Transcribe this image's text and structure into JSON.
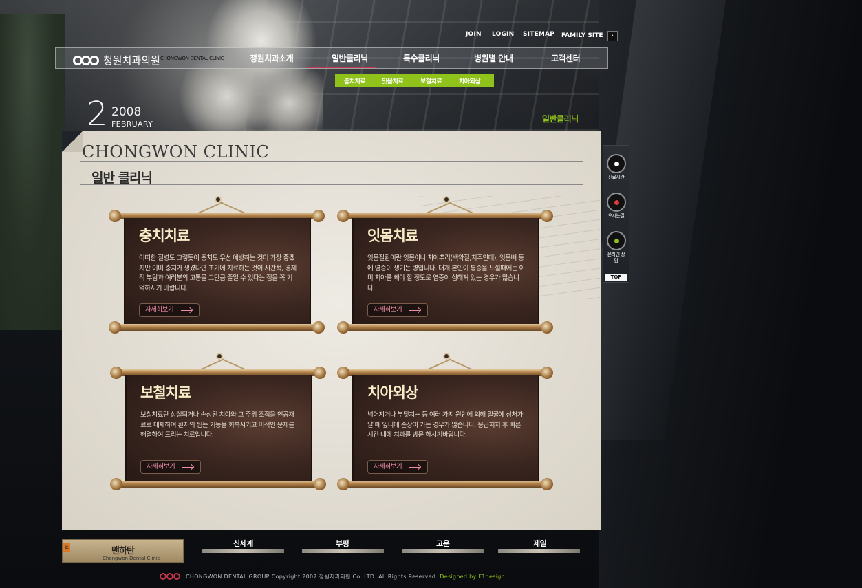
{
  "utility": {
    "join": "JOIN",
    "login": "LOGIN",
    "sitemap": "SITEMAP",
    "family_site": "FAMILY SITE",
    "family_btn": "›"
  },
  "logo": {
    "name": "청원치과의원",
    "sub": "CHONGWON DENTAL CLINIC"
  },
  "nav": {
    "items": [
      "청원치과소개",
      "일반클리닉",
      "특수클리닉",
      "병원별 안내",
      "고객센터"
    ],
    "active_index": 1
  },
  "subnav": {
    "items": [
      "충치치료",
      "잇몸치료",
      "보철치료",
      "치아외상"
    ]
  },
  "date": {
    "day": "2",
    "year": "2008",
    "month": "FEBRUARY"
  },
  "section_tag": "일반클리닉",
  "content": {
    "clinic_title": "CHONGWON CLINIC",
    "page_title": "일반 클리닉",
    "cards": [
      {
        "title": "충치치료",
        "text": "어떠한 질병도 그렇듯이 충치도 우선 예방하는 것이 가장 좋겠지만 이미 충치가 생겼다면 초기에 치료하는 것이 시간적, 경제적 부담과 여러분의 고통을 그만큼 줄일 수 있다는 점을 꼭 기억하시기 바랍니다.",
        "button": "자세히보기"
      },
      {
        "title": "잇몸치료",
        "text": "잇몸질환이란 잇몸이나 치아뿌리(백악질,치주인대), 잇몸뼈 등에 염증이 생기는 병입니다. 대개 본인이 통증을 느낄때에는 이미 치아를 빼야 할 정도로 염증이 심해져 있는 경우가 많습니다.",
        "button": "자세히보기"
      },
      {
        "title": "보철치료",
        "text": "보철치료란 상실되거나 손상된 치아와 그 주위 조직을 인공재료로 대체하여 환자의 씹는 기능을 회복시키고 미적인 문제를 해결하여 드리는 치료입니다.",
        "button": "자세히보기"
      },
      {
        "title": "치아외상",
        "text": "넘어지거나 부딪치는 등 여러 가지 원인에 의해 얼굴에 상처가 날 때 잎니에 손상이 가는 경우가 많습니다. 응급처치 후 빠른 시간 내에 치과를 방문 하시기바랍니다.",
        "button": "자세히보기"
      }
    ]
  },
  "quick_menu": {
    "items": [
      "진료시간",
      "오시는길",
      "온라인 상담"
    ],
    "top": "TOP"
  },
  "branches": {
    "main": "맨하탄",
    "main_sub": "Chongwon Dental Clinic",
    "main_tag": "≥",
    "items": [
      "신세계",
      "부평",
      "고운",
      "제일"
    ]
  },
  "footer": {
    "copyright": "CHONGWON DENTAL GROUP Copyright 2007 청원치과의원 Co.,LTD. All Rights Reserved",
    "credit": "Designed by F1design"
  },
  "colors": {
    "accent_green": "#8fc21a",
    "accent_red": "#c3364b",
    "button_text_pink": "#f08fa4"
  }
}
